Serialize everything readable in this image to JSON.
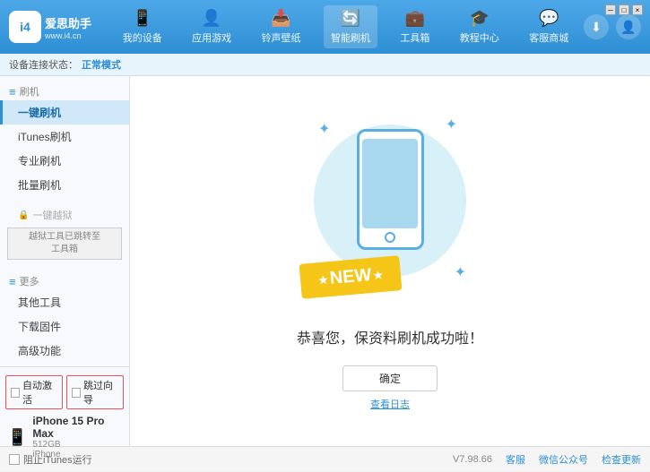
{
  "app": {
    "logo_icon": "i4",
    "logo_name": "爱思助手",
    "logo_url": "www.i4.cn"
  },
  "nav": {
    "tabs": [
      {
        "id": "my-device",
        "icon": "📱",
        "label": "我的设备"
      },
      {
        "id": "app-game",
        "icon": "👤",
        "label": "应用游戏"
      },
      {
        "id": "ringtone",
        "icon": "📥",
        "label": "铃声壁纸"
      },
      {
        "id": "smart-flash",
        "icon": "🔄",
        "label": "智能刷机",
        "active": true
      },
      {
        "id": "toolbox",
        "icon": "💼",
        "label": "工具箱"
      },
      {
        "id": "tutorial",
        "icon": "🎓",
        "label": "教程中心"
      },
      {
        "id": "service",
        "icon": "💬",
        "label": "客服商城"
      }
    ]
  },
  "status_bar": {
    "prefix": "设备连接状态：",
    "status": "正常模式"
  },
  "sidebar": {
    "flash_label": "刷机",
    "items": [
      {
        "id": "one-key-flash",
        "label": "一键刷机",
        "active": true
      },
      {
        "id": "itunes-flash",
        "label": "iTunes刷机"
      },
      {
        "id": "pro-flash",
        "label": "专业刷机"
      },
      {
        "id": "batch-flash",
        "label": "批量刷机"
      }
    ],
    "disabled_label": "一键越狱",
    "disabled_note": "越狱工具已跳转至\n工具箱",
    "more_label": "更多",
    "more_items": [
      {
        "id": "other-tools",
        "label": "其他工具"
      },
      {
        "id": "download-firmware",
        "label": "下载固件"
      },
      {
        "id": "advanced",
        "label": "高级功能"
      }
    ]
  },
  "device_panel": {
    "auto_activate": "自动激活",
    "guide_label": "跳过向导",
    "device_name": "iPhone 15 Pro Max",
    "device_storage": "512GB",
    "device_type": "iPhone"
  },
  "content": {
    "success_msg": "恭喜您，保资料刷机成功啦！",
    "confirm_btn": "确定",
    "log_btn": "查看日志",
    "new_badge": "NEW"
  },
  "bottom_bar": {
    "itunes_label": "阻止iTunes运行",
    "version": "V7.98.66",
    "link1": "客服",
    "link2": "微信公众号",
    "link3": "检查更新"
  },
  "window_controls": {
    "minimize": "─",
    "maximize": "□",
    "close": "×"
  }
}
